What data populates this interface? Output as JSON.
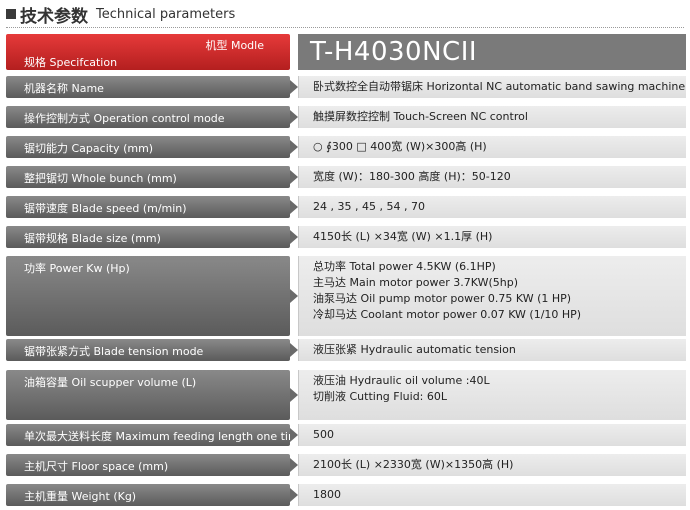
{
  "title": {
    "cn": "技术参数",
    "en": "Technical parameters"
  },
  "header": {
    "model_label": "机型 Modle",
    "spec_label": "规格 Specifcation",
    "model": "T-H4030NCII"
  },
  "rows": [
    {
      "label": "机器名称 Name",
      "lines": [
        "卧式数控全自动带锯床 Horizontal NC automatic band sawing machine"
      ]
    },
    {
      "label": "操作控制方式 Operation control mode",
      "lines": [
        "触摸屏数控控制 Touch-Screen NC control"
      ]
    },
    {
      "label": "锯切能力 Capacity (mm)",
      "lines": [
        "○ ∮300   □ 400宽 (W)×300高 (H)"
      ]
    },
    {
      "label": "整把锯切 Whole bunch (mm)",
      "lines": [
        "宽度 (W)：180-300    高度 (H)：50-120"
      ]
    },
    {
      "label": "锯带速度 Blade speed (m/min)",
      "lines": [
        "24 , 35 , 45 , 54 , 70"
      ]
    },
    {
      "label": "锯带规格 Blade size (mm)",
      "lines": [
        "4150长 (L) ×34宽 (W) ×1.1厚 (H)"
      ]
    },
    {
      "label": "功率 Power Kw (Hp)",
      "lines": [
        "总功率 Total power 4.5KW (6.1HP)",
        "主马达 Main motor power 3.7KW(5hp)",
        "油泵马达 Oil pump motor power 0.75 KW (1 HP)",
        "冷却马达 Coolant motor power 0.07 KW (1/10 HP)"
      ]
    },
    {
      "label": "锯带张紧方式 Blade tension mode",
      "lines": [
        "液压张紧 Hydraulic automatic tension"
      ]
    },
    {
      "label": "油箱容量 Oil scupper volume (L)",
      "lines": [
        "液压油 Hydraulic oil volume :40L",
        "切削液 Cutting Fluid: 60L"
      ]
    },
    {
      "label": "单次最大送料长度 Maximum feeding length one time (mm)",
      "lines": [
        "500"
      ]
    },
    {
      "label": "主机尺寸 Floor space (mm)",
      "lines": [
        "2100长 (L) ×2330宽 (W)×1350高 (H)"
      ]
    },
    {
      "label": "主机重量 Weight (Kg)",
      "lines": [
        "1800"
      ]
    }
  ]
}
